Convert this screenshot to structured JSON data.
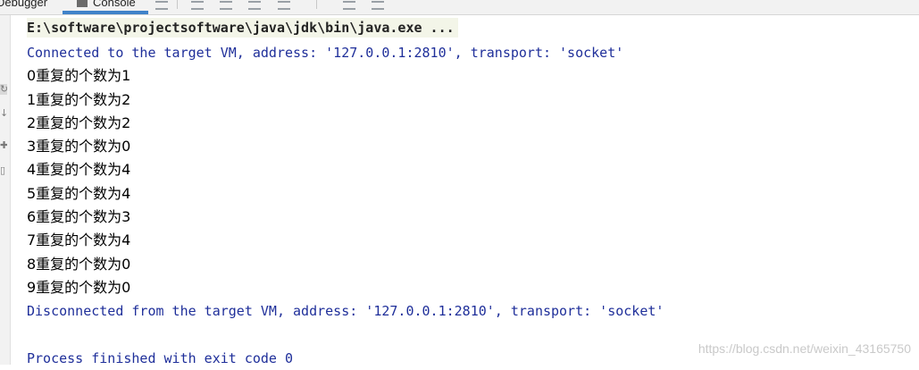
{
  "tabs": {
    "debugger": "Debugger",
    "console": "Console"
  },
  "console": {
    "command": "E:\\software\\projectsoftware\\java\\jdk\\bin\\java.exe ...",
    "connected": "Connected to the target VM, address: '127.0.0.1:2810', transport: 'socket'",
    "output": [
      "0重复的个数为1",
      "1重复的个数为2",
      "2重复的个数为2",
      "3重复的个数为0",
      "4重复的个数为4",
      "5重复的个数为4",
      "6重复的个数为3",
      "7重复的个数为4",
      "8重复的个数为0",
      "9重复的个数为0"
    ],
    "disconnected": "Disconnected from the target VM, address: '127.0.0.1:2810', transport: 'socket'",
    "finished": "Process finished with exit code 0"
  },
  "watermark": "https://blog.csdn.net/weixin_43165750",
  "colors": {
    "system_text": "#1f2f9a",
    "command_bg": "#f3f5e8",
    "tab_active": "#4083c9"
  },
  "icons": [
    "rerun-icon",
    "download-icon",
    "pin-icon",
    "delete-icon"
  ]
}
